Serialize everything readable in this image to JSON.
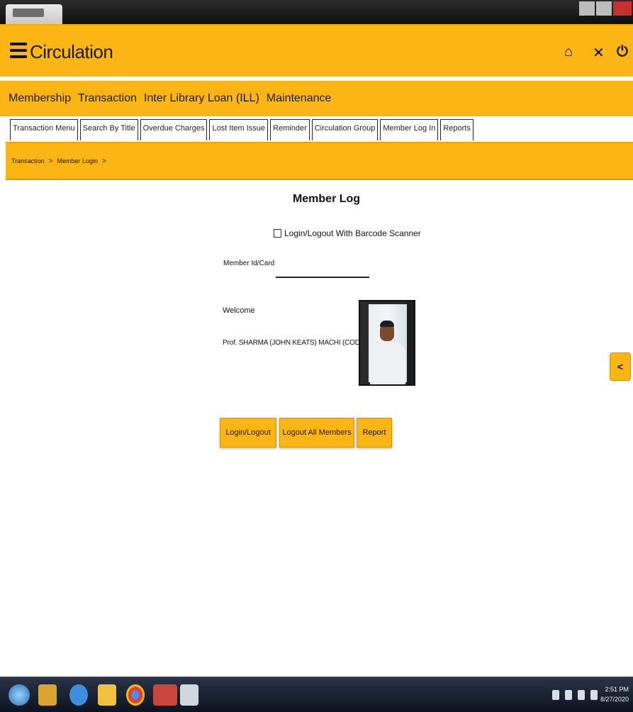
{
  "header": {
    "title": "Circulation",
    "icons": [
      "menu-icon",
      "home-icon",
      "close-icon",
      "power-icon"
    ]
  },
  "main_nav": {
    "items": [
      "Membership",
      "Transaction",
      "Inter Library Loan (ILL)",
      "Maintenance"
    ]
  },
  "sub_tabs": [
    "Transaction Menu",
    "Search By Title",
    "Overdue Charges",
    "Lost Item Issue",
    "Reminder",
    "Circulation Group",
    "Member Log In",
    "Reports"
  ],
  "breadcrumb": {
    "items": [
      "Transaction",
      "Member Login"
    ],
    "separator": ">"
  },
  "content": {
    "title": "Member Log",
    "checkbox_label": "Login/Logout With Barcode Scanner",
    "member_label": "Member Id/Card",
    "member_value": "",
    "welcome_label": "Welcome",
    "member_name": "Prof. SHARMA (JOHN KEATS) MACHI (CODE)"
  },
  "buttons": {
    "logout": "Login/Logout",
    "logout_all": "Logout All Members",
    "report": "Report"
  },
  "side_tab": "<",
  "taskbar": {
    "time": "2:51 PM",
    "date": "8/27/2020"
  },
  "colors": {
    "accent": "#fbb616",
    "text": "#111111",
    "taskbar": "#0d1320"
  }
}
